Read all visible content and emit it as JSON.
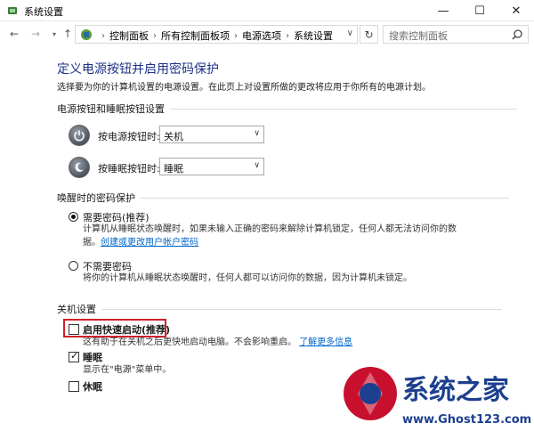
{
  "window": {
    "title": "系统设置",
    "minimize_glyph": "—",
    "maximize_glyph": "☐",
    "close_glyph": "✕"
  },
  "nav": {
    "back_glyph": "←",
    "forward_glyph": "→",
    "recent_glyph": "▾",
    "up_glyph": "↑",
    "refresh_glyph": "↻",
    "breadcrumb": [
      "控制面板",
      "所有控制面板项",
      "电源选项",
      "系统设置"
    ],
    "search_placeholder": "搜索控制面板"
  },
  "page": {
    "title": "定义电源按钮并启用密码保护",
    "description": "选择要为你的计算机设置的电源设置。在此页上对设置所做的更改将应用于你所有的电源计划。"
  },
  "power_buttons": {
    "section_title": "电源按钮和睡眠按钮设置",
    "power_button": {
      "label": "按电源按钮时:",
      "value": "关机"
    },
    "sleep_button": {
      "label": "按睡眠按钮时:",
      "value": "睡眠"
    }
  },
  "wake_password": {
    "section_title": "唤醒时的密码保护",
    "require": {
      "label": "需要密码(推荐)",
      "checked": true,
      "desc_line1": "计算机从睡眠状态唤醒时，如果未输入正确的密码来解除计算机锁定，任何人都无法访问你的数",
      "desc_line2": "据。",
      "link": "创建或更改用户帐户密码"
    },
    "no_require": {
      "label": "不需要密码",
      "checked": false,
      "desc": "将你的计算机从睡眠状态唤醒时，任何人都可以访问你的数据，因为计算机未锁定。"
    }
  },
  "shutdown": {
    "section_title": "关机设置",
    "fast_startup": {
      "label": "启用快速启动(推荐)",
      "checked": false,
      "desc": "这有助于在关机之后更快地启动电脑。不会影响重启。",
      "link": "了解更多信息"
    },
    "sleep": {
      "label": "睡眠",
      "checked": true,
      "desc": "显示在\"电源\"菜单中。"
    },
    "hibernate": {
      "label": "休眠",
      "checked": false
    }
  },
  "watermark": {
    "brand": "系统之家",
    "url": "www.Ghost123.com"
  },
  "colors": {
    "title_blue": "#1e3287",
    "link_blue": "#0066cc",
    "highlight_red": "#d0202a",
    "watermark_blue": "#1d3f8f"
  },
  "icons": {
    "title": "power-options-icon",
    "address": "control-panel-icon",
    "search": "search-icon",
    "power_button": "power-button-icon",
    "sleep_button": "sleep-button-icon"
  }
}
